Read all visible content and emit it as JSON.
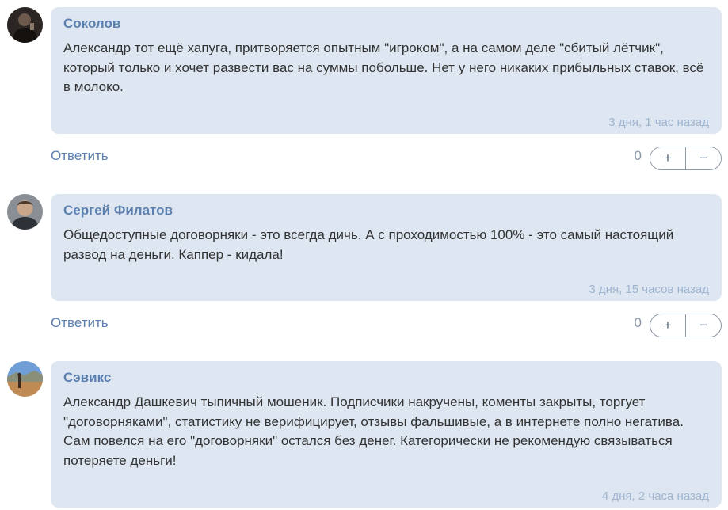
{
  "comments": [
    {
      "avatar": "avatar-dark",
      "author": "Соколов",
      "text": "Александр тот ещё хапуга, притворяется опытным \"игроком\", а на самом деле \"сбитый лётчик\", который только и хочет развести вас на суммы побольше. Нет у него никаких прибыльных ставок, всё в молоко.",
      "time": "3 дня, 1 час назад",
      "reply_label": "Ответить",
      "score": "0",
      "plus": "+",
      "minus": "−"
    },
    {
      "avatar": "avatar-man",
      "author": "Сергей Филатов",
      "text": "Общедоступные договорняки - это всегда дичь. А с проходимостью 100% - это самый настоящий развод на деньги. Каппер - кидала!",
      "time": "3 дня, 15 часов назад",
      "reply_label": "Ответить",
      "score": "0",
      "plus": "+",
      "minus": "−"
    },
    {
      "avatar": "avatar-landscape",
      "author": "Сэвикс",
      "text": "Александр Дашкевич тыпичный мошеник. Подписчики накручены, коменты закрыты, торгует \"договорняками\", статистику не верифицирует, отзывы фальшивые, а в интернете полно негатива. Сам повелся на его \"договорняки\" остался без денег. Категорически не рекомендую связываться потеряете деньги!",
      "time": "4 дня, 2 часа назад"
    }
  ],
  "colors": {
    "bubble": "#dde6f1",
    "author": "#5b7fae",
    "timestamp": "#9fb5d0",
    "link": "#5b7fae"
  }
}
